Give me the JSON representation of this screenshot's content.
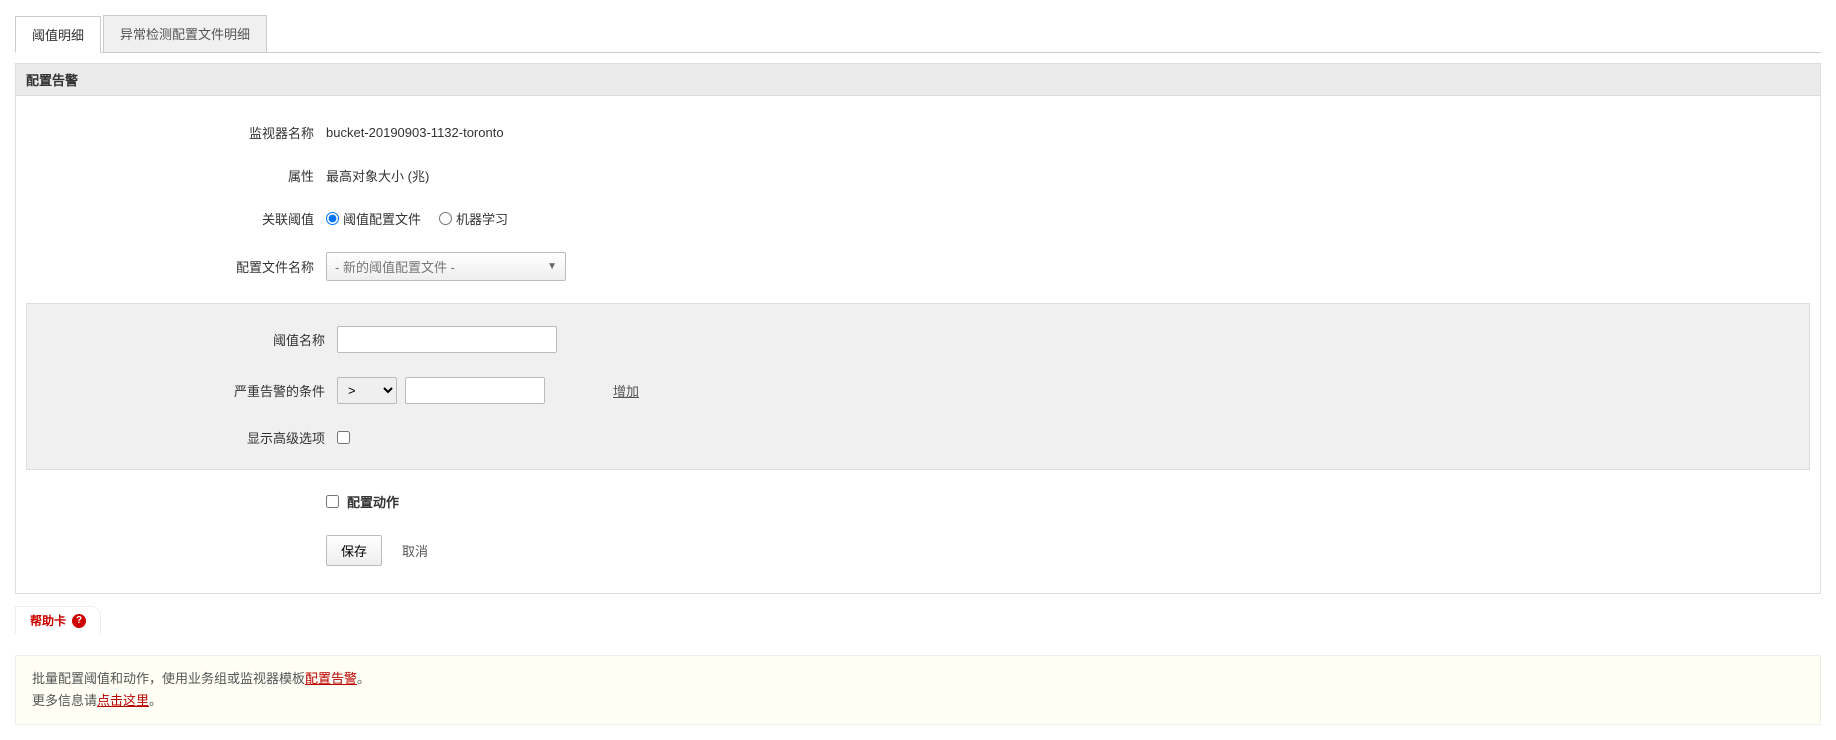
{
  "tabs": {
    "threshold": "阈值明细",
    "anomaly": "异常检测配置文件明细"
  },
  "panel": {
    "title": "配置告警"
  },
  "labels": {
    "monitor_name": "监视器名称",
    "attribute": "属性",
    "assoc_threshold": "关联阈值",
    "profile_name": "配置文件名称",
    "threshold_name": "阈值名称",
    "critical_condition": "严重告警的条件",
    "show_advanced": "显示高级选项",
    "configure_action": "配置动作"
  },
  "values": {
    "monitor_name": "bucket-20190903-1132-toronto",
    "attribute": "最高对象大小 (兆)",
    "threshold_profile_option": "阈值配置文件",
    "ml_option": "机器学习",
    "profile_dropdown": "- 新的阈值配置文件 -",
    "operator": ">"
  },
  "actions": {
    "add": "增加",
    "save": "保存",
    "cancel": "取消"
  },
  "help": {
    "title": "帮助卡",
    "icon_text": "?",
    "line1_prefix": "批量配置阈值和动作，使用业务组或监视器模板",
    "line1_link": "配置告警",
    "line1_suffix": "。",
    "line2_prefix": "更多信息请",
    "line2_link": "点击这里",
    "line2_suffix": "。"
  }
}
